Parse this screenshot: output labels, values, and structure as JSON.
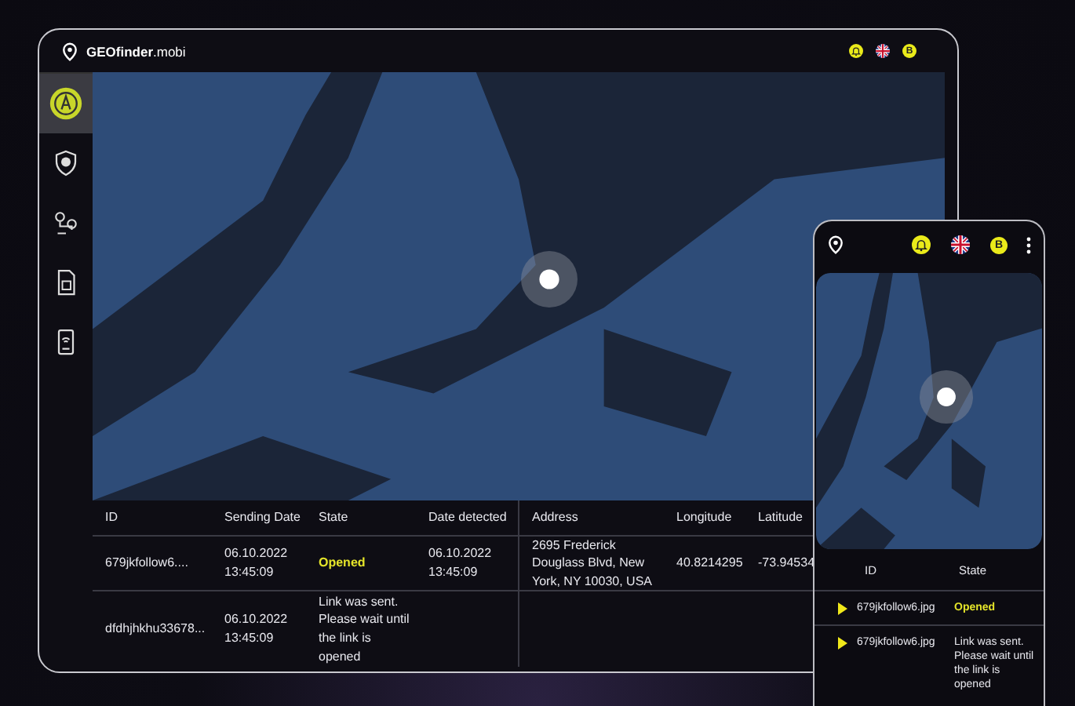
{
  "laptop": {
    "brand": "**GEOfinder**.mobi",
    "header": {
      "account_badge": "B"
    },
    "sidebar": {
      "items": [
        {
          "selected": true
        },
        {
          "selected": false
        },
        {
          "selected": false
        },
        {
          "selected": false
        },
        {
          "selected": false
        }
      ]
    },
    "table": {
      "columns": [
        "ID",
        "Sending Date",
        "State",
        "Date detected",
        "Address",
        "Longitude",
        "Latitude"
      ],
      "rows": [
        {
          "id": "679jkfollow6....",
          "sending_date": "06.10.2022 13:45:09",
          "state": "Opened",
          "color": "#e4e42a",
          "date_detected": "06.10.2022 13:45:09",
          "address": "2695 Frederick Douglass Blvd, New York, NY 10030, USA",
          "longitude": "40.8214295",
          "latitude": "-73.94534"
        },
        {
          "id": "dfdhjhkhu33678...",
          "sending_date": "06.10.2022 13:45:09",
          "state": "Link was sent. Please wait until the link is opened"
        }
      ]
    }
  },
  "phone": {
    "header": {
      "account_badge": "B"
    },
    "table": {
      "columns": [
        "ID",
        "State"
      ],
      "rows": [
        {
          "id": "679jkfollow6.jpg",
          "state": "Opened",
          "color": "#e4e42a"
        },
        {
          "id": "679jkfollow6.jpg",
          "state": "Link was sent. Please wait until the link is opened"
        }
      ]
    }
  }
}
